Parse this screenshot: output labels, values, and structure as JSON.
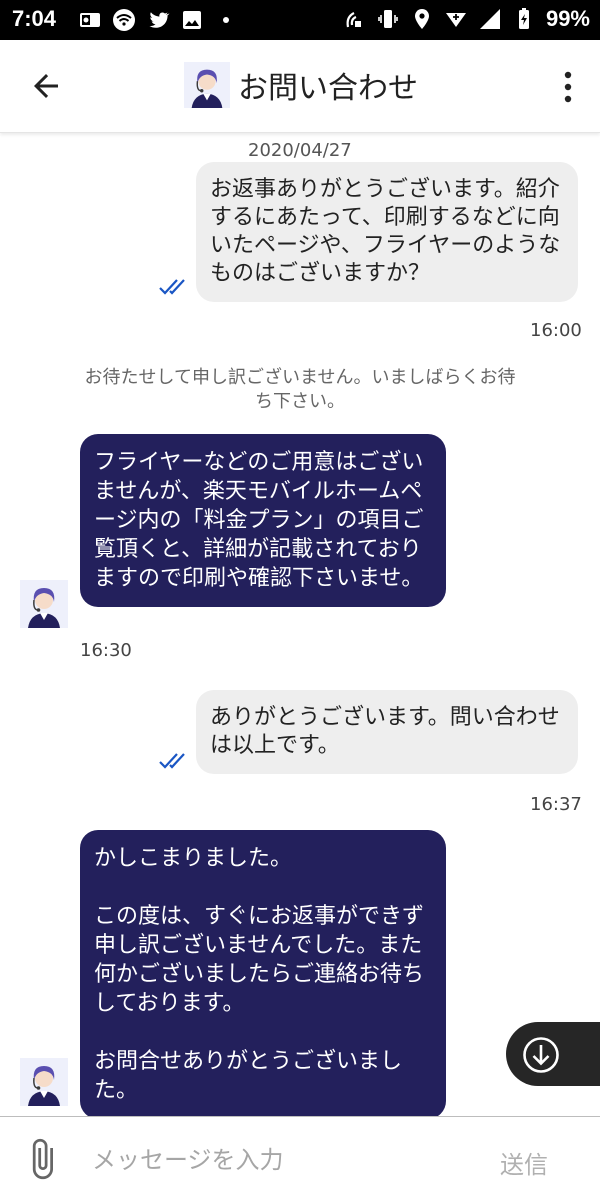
{
  "status_bar": {
    "time": "7:04",
    "battery": "99%"
  },
  "header": {
    "title": "お問い合わせ",
    "back_icon": "arrow-left-icon",
    "menu_icon": "more-vert-icon"
  },
  "chat": {
    "date": "2020/04/27",
    "messages": [
      {
        "type": "out",
        "text": "お返事ありがとうございます。紹介するにあたって、印刷するなどに向いたページや、フライヤーのようなものはございますか？",
        "time": "16:00"
      },
      {
        "type": "system",
        "text": "お待たせして申し訳ございません。いましばらくお待ち下さい。"
      },
      {
        "type": "in",
        "text": "フライヤーなどのご用意はございませんが、楽天モバイルホームページ内の「料金プラン」の項目ご覧頂くと、詳細が記載されておりますので印刷や確認下さいませ。",
        "time": "16:30"
      },
      {
        "type": "out",
        "text": "ありがとうございます。問い合わせは以上です。",
        "time": "16:37"
      },
      {
        "type": "in",
        "text": "かしこまりました。\n\nこの度は、すぐにお返事ができず申し訳ございませんでした。また何かございましたらご連絡お待ちしております。\n\nお問合せありがとうございました。"
      }
    ]
  },
  "input_bar": {
    "placeholder": "メッセージを入力",
    "send_label": "送信",
    "attach_icon": "paperclip-icon"
  },
  "colors": {
    "agent_bubble": "#23205c",
    "user_bubble": "#eeeeee",
    "read_check": "#1a56c4"
  }
}
